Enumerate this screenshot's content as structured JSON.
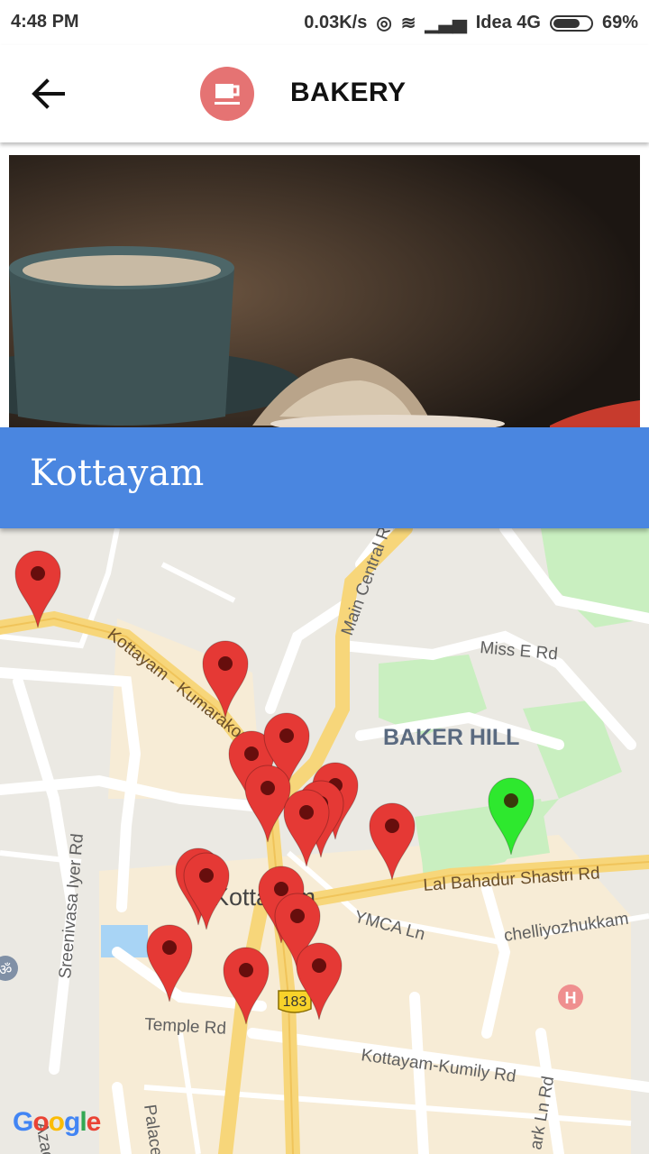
{
  "status_bar": {
    "time": "4:48 PM",
    "speed": "0.03K/s",
    "carrier": "Idea 4G",
    "battery": "69%"
  },
  "app_bar": {
    "title": "BAKERY",
    "back_icon": "arrow-left-icon",
    "logo_icon": "coffee-cup-icon"
  },
  "banner": {
    "city": "Kottayam"
  },
  "map": {
    "labels": {
      "main_central_road": "Main Central Road",
      "kottayam_kumarakom": "Kottayam - Kumarakom",
      "miss_e_rd": "Miss E Rd",
      "baker_hill": "BAKER HILL",
      "lal_bahadur": "Lal Bahadur Shastri Rd",
      "sreenivasa": "Sreenivasa Iyer Rd",
      "ymca": "YMCA Ln",
      "chelliyozhukkam": "chelliyozhukkam",
      "kottayam": "Kottayam",
      "temple_rd": "Temple Rd",
      "kottayam_kumily": "Kottayam-Kumily Rd",
      "azad": "Azad Ln",
      "palace": "Palace",
      "ark_ln": "ark Ln Rd",
      "route_183": "183"
    },
    "attribution": "Google",
    "marker_color": "#e53935",
    "selected_marker_color": "#2ee82e",
    "hospital_icon": "hospital-icon",
    "temple_icon": "om-icon"
  }
}
